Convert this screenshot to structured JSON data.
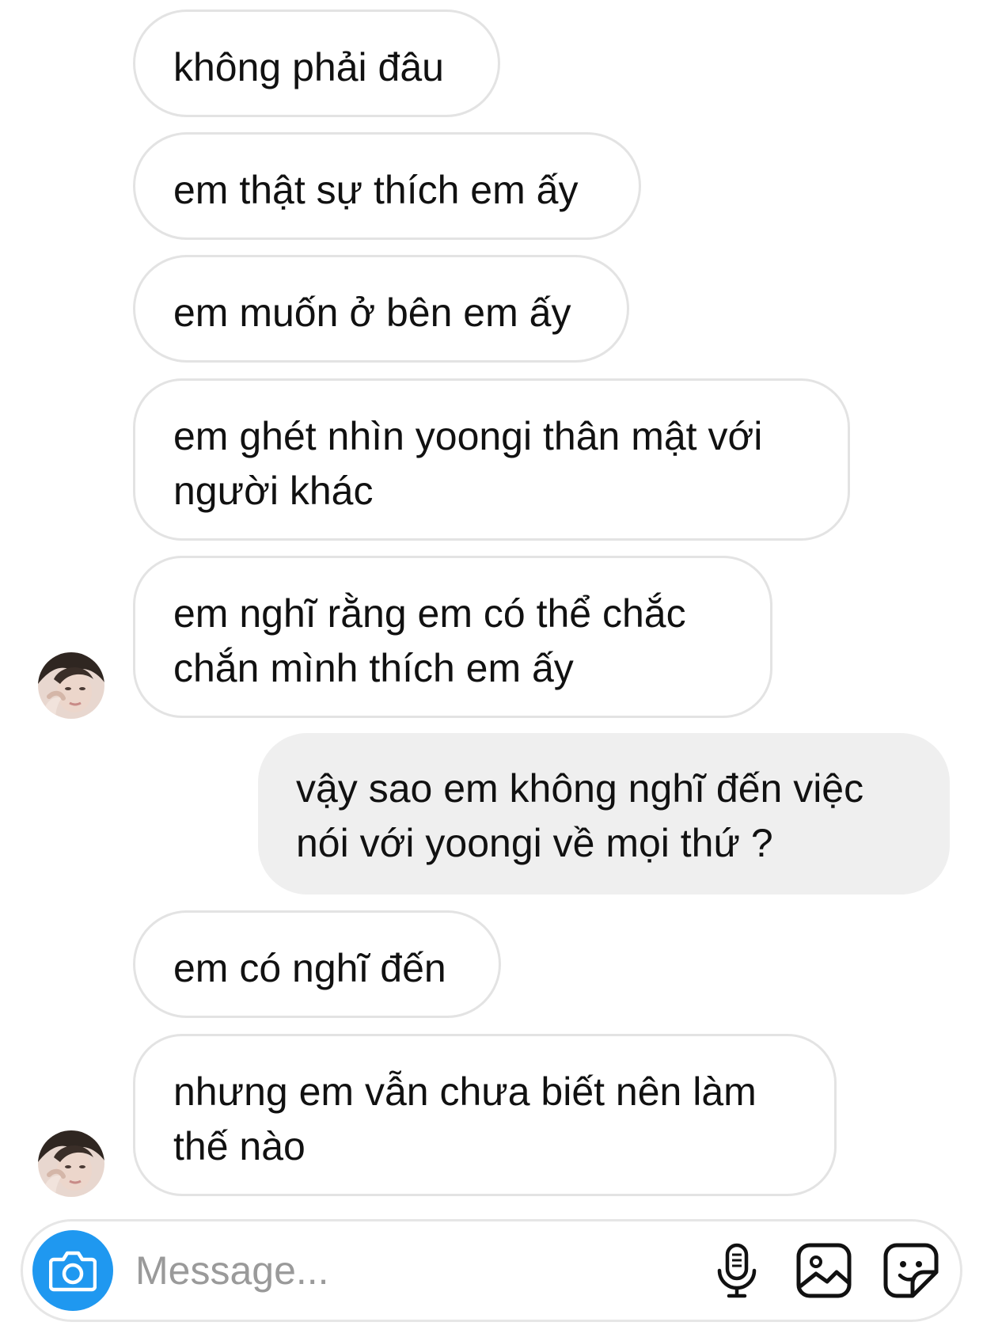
{
  "conversation": {
    "messages": [
      {
        "direction": "incoming",
        "lines": [
          "không phải đâu"
        ]
      },
      {
        "direction": "incoming",
        "lines": [
          "em thật sự thích em ấy"
        ]
      },
      {
        "direction": "incoming",
        "lines": [
          "em muốn ở bên em ấy"
        ]
      },
      {
        "direction": "incoming",
        "lines": [
          "em ghét nhìn yoongi thân mật với",
          "người khác"
        ]
      },
      {
        "direction": "incoming",
        "lines": [
          "em nghĩ rằng em có thể chắc",
          "chắn mình thích em ấy"
        ]
      },
      {
        "direction": "outgoing",
        "lines": [
          "vậy sao em không nghĩ đến việc",
          "nói với yoongi về mọi thứ ?"
        ]
      },
      {
        "direction": "incoming",
        "lines": [
          "em có nghĩ đến"
        ]
      },
      {
        "direction": "incoming",
        "lines": [
          "nhưng em vẫn chưa biết nên làm",
          "thế nào"
        ]
      }
    ]
  },
  "composer": {
    "placeholder": "Message...",
    "value": "",
    "camera_icon": "camera-icon",
    "mic_icon": "microphone-icon",
    "gallery_icon": "photo-gallery-icon",
    "sticker_icon": "sticker-icon"
  },
  "colors": {
    "accent": "#1f98f0",
    "incoming_border": "#e3e3e3",
    "outgoing_fill": "#efefef",
    "placeholder": "#9a9a9a"
  }
}
